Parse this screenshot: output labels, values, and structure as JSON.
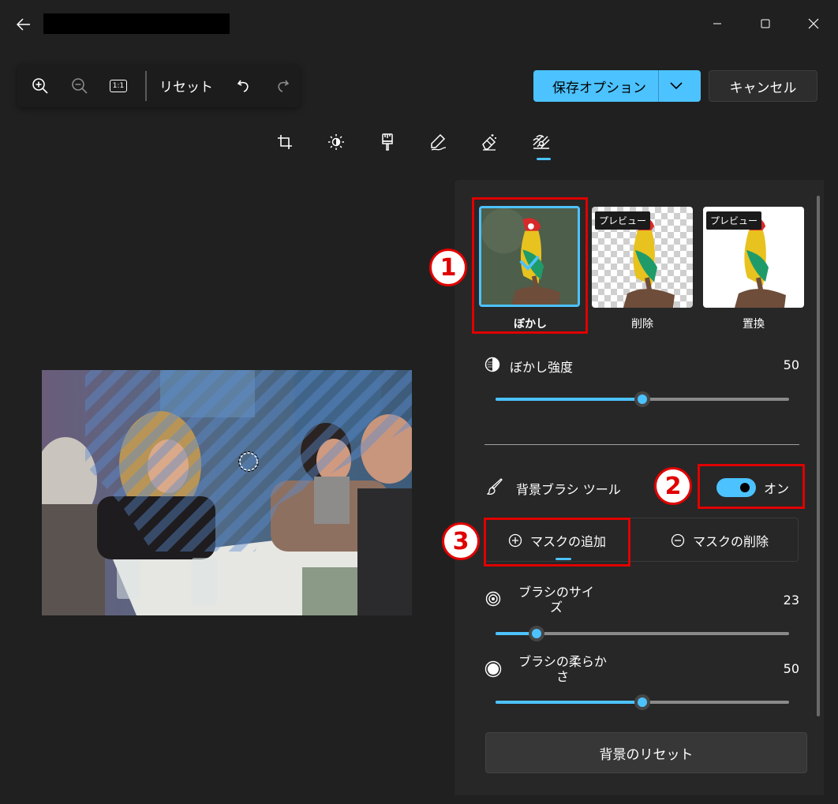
{
  "window": {
    "back_icon": "arrow-left-icon",
    "controls": [
      "minimize-icon",
      "maximize-icon",
      "close-icon"
    ]
  },
  "zoom_toolbar": {
    "zoom_in_icon": "zoom-in-icon",
    "zoom_out_icon": "zoom-out-icon",
    "actual_size_label": "1:1",
    "reset_label": "リセット",
    "undo_icon": "undo-icon",
    "redo_icon": "redo-icon"
  },
  "actions": {
    "save_label": "保存オプション",
    "cancel_label": "キャンセル"
  },
  "tool_tabs": [
    "crop-icon",
    "brightness-icon",
    "filter-brush-icon",
    "markup-pen-icon",
    "retouch-eraser-icon",
    "background-icon"
  ],
  "active_tab": 5,
  "background_panel": {
    "modes": [
      {
        "label": "ぼかし",
        "badge": "",
        "selected": true
      },
      {
        "label": "削除",
        "badge": "プレビュー",
        "selected": false
      },
      {
        "label": "置換",
        "badge": "プレビュー",
        "selected": false
      }
    ],
    "blur_strength": {
      "label": "ぼかし強度",
      "value": "50",
      "fraction": 0.5
    },
    "brush_tool": {
      "label": "背景ブラシ ツール",
      "toggle_label": "オン",
      "on": true
    },
    "mask_add_label": "マスクの追加",
    "mask_remove_label": "マスクの削除",
    "brush_size": {
      "label_line1": "ブラシのサイ",
      "label_line2": "ズ",
      "value": "23",
      "fraction": 0.14
    },
    "brush_softness": {
      "label_line1": "ブラシの柔らか",
      "label_line2": "さ",
      "value": "50",
      "fraction": 0.5
    },
    "reset_label": "背景のリセット"
  },
  "annotations": [
    "1",
    "2",
    "3"
  ],
  "colors": {
    "accent": "#4cc2ff",
    "highlight_red": "#e00000",
    "background": "#202020",
    "panel": "#272727"
  }
}
